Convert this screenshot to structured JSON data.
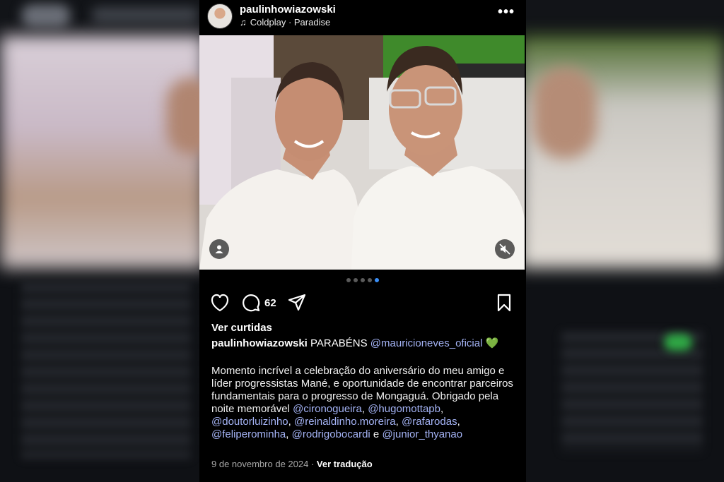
{
  "post": {
    "username": "paulinhowiazowski",
    "music": "Coldplay · Paradise",
    "comments_count": "62",
    "likes_label": "Ver curtidas",
    "caption_text": "PARABÉNS",
    "caption_mention": "@mauricioneves_oficial",
    "caption_emoji": "💚",
    "body_intro": "Momento incrível a celebração do aniversário do meu amigo e líder progressistas Mané, e oportunidade de encontrar parceiros fundamentais para o progresso de Mongaguá. Obrigado pela noite memorável",
    "mentions": [
      "@cironogueira",
      "@hugomottapb",
      "@doutorluizinho",
      "@reinaldinho.moreira",
      "@rafarodas",
      "@feliperominha",
      "@rodrigobocardi",
      "@junior_thyanao"
    ],
    "conjunction": "e",
    "date": "9 de novembro de 2024",
    "separator": "·",
    "translate_label": "Ver tradução",
    "carousel": {
      "count": 5,
      "active_index": 4
    }
  },
  "icons": {
    "more": "more-icon",
    "music": "music-note-icon",
    "like": "heart-icon",
    "comment": "comment-icon",
    "share": "send-icon",
    "save": "bookmark-icon",
    "tag": "person-tag-icon",
    "mute": "speaker-muted-icon"
  },
  "colors": {
    "mention": "#a4b3f5",
    "active_dot": "#3a8ef6"
  }
}
